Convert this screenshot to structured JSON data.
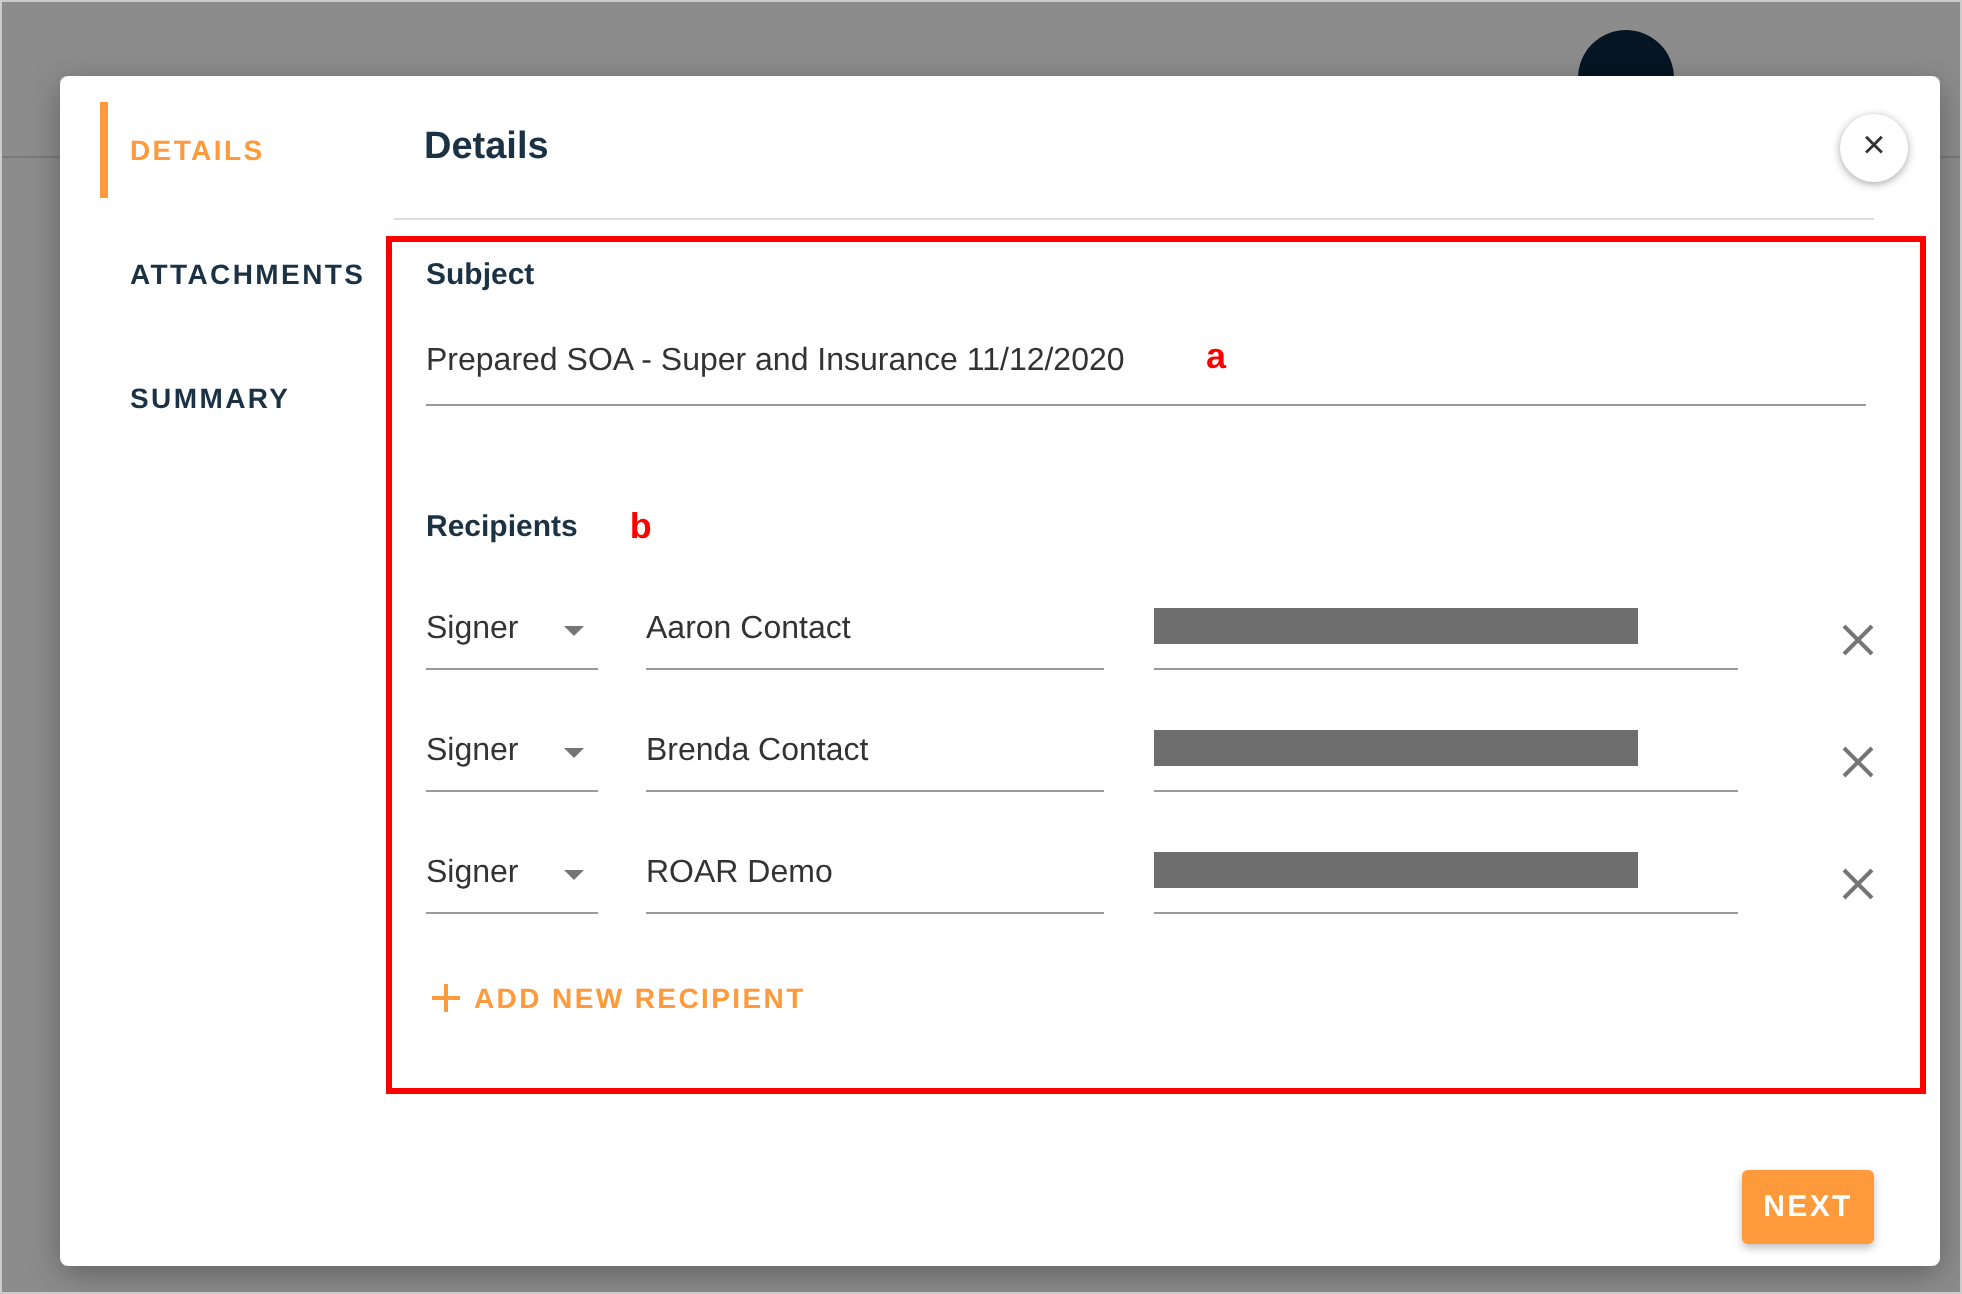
{
  "dialog": {
    "nav": [
      {
        "label": "DETAILS",
        "selected": true
      },
      {
        "label": "ATTACHMENTS",
        "selected": false
      },
      {
        "label": "SUMMARY",
        "selected": false
      }
    ],
    "title": "Details",
    "close": "×",
    "subject": {
      "label": "Subject",
      "value": "Prepared SOA - Super and Insurance 11/12/2020"
    },
    "recipients": {
      "label": "Recipients",
      "rows": [
        {
          "role": "Signer",
          "name": "Aaron Contact",
          "email_redacted": true
        },
        {
          "role": "Signer",
          "name": "Brenda Contact",
          "email_redacted": true
        },
        {
          "role": "Signer",
          "name": "ROAR Demo",
          "email_redacted": true
        }
      ],
      "add": "ADD NEW RECIPIENT"
    },
    "next": "NEXT"
  },
  "annotations": [
    {
      "label": "a"
    },
    {
      "label": "b"
    }
  ]
}
